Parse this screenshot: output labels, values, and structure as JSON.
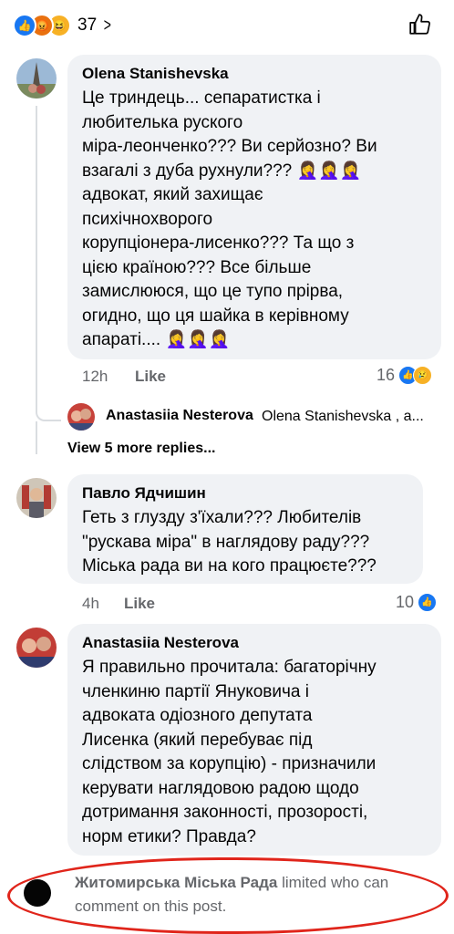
{
  "post": {
    "reaction_count": "37",
    "reaction_icons": [
      "like-icon",
      "angry-icon",
      "haha-icon"
    ]
  },
  "comments": [
    {
      "author": "Olena Stanishevska",
      "text": "Це триндець... сепаратистка і\nлюбителька руского\nміра-леонченко??? Ви серйозно? Ви\nвзагалі з дуба рухнули??? 🤦‍♀️🤦‍♀️🤦‍♀️\nадвокат, який захищає\nпсихічнохворого\nкорупціонера-лисенко??? Та що з\nцією країною??? Все більше\nзамислююся, що це тупо прірва,\nогидно, що ця шайка в керівному\nапараті.... 🤦‍♀️🤦‍♀️🤦‍♀️",
      "time": "12h",
      "like_label": "Like",
      "reaction_count": "16"
    },
    {
      "author": "Павло Ядчишин",
      "text": "Геть з глузду з'їхали??? Любителів\n\"рускава міра\" в наглядову раду???\nМіська рада ви на кого працюєте???",
      "time": "4h",
      "like_label": "Like",
      "reaction_count": "10"
    },
    {
      "author": "Anastasiia Nesterova",
      "text": "Я правильно прочитала: багаторічну\nчленкиню партії Януковича і\nадвоката одіозного депутата\nЛисенка (який перебуває під\nслідством за корупцію) - призначили\nкерувати наглядовою радою щодо\nдотримання законності, прозорості,\nнорм етики? Правда?"
    }
  ],
  "reply": {
    "author": "Anastasiia Nesterova",
    "snippet": "Olena Stanishevska , a..."
  },
  "view_more": "View 5 more replies...",
  "footer": {
    "page_name": "Житомирська Міська Рада",
    "notice": " limited who can comment on this post."
  },
  "colors": {
    "bubble": "#f0f2f5",
    "like_blue": "#1877f2",
    "annotation_red": "#e0251b"
  }
}
